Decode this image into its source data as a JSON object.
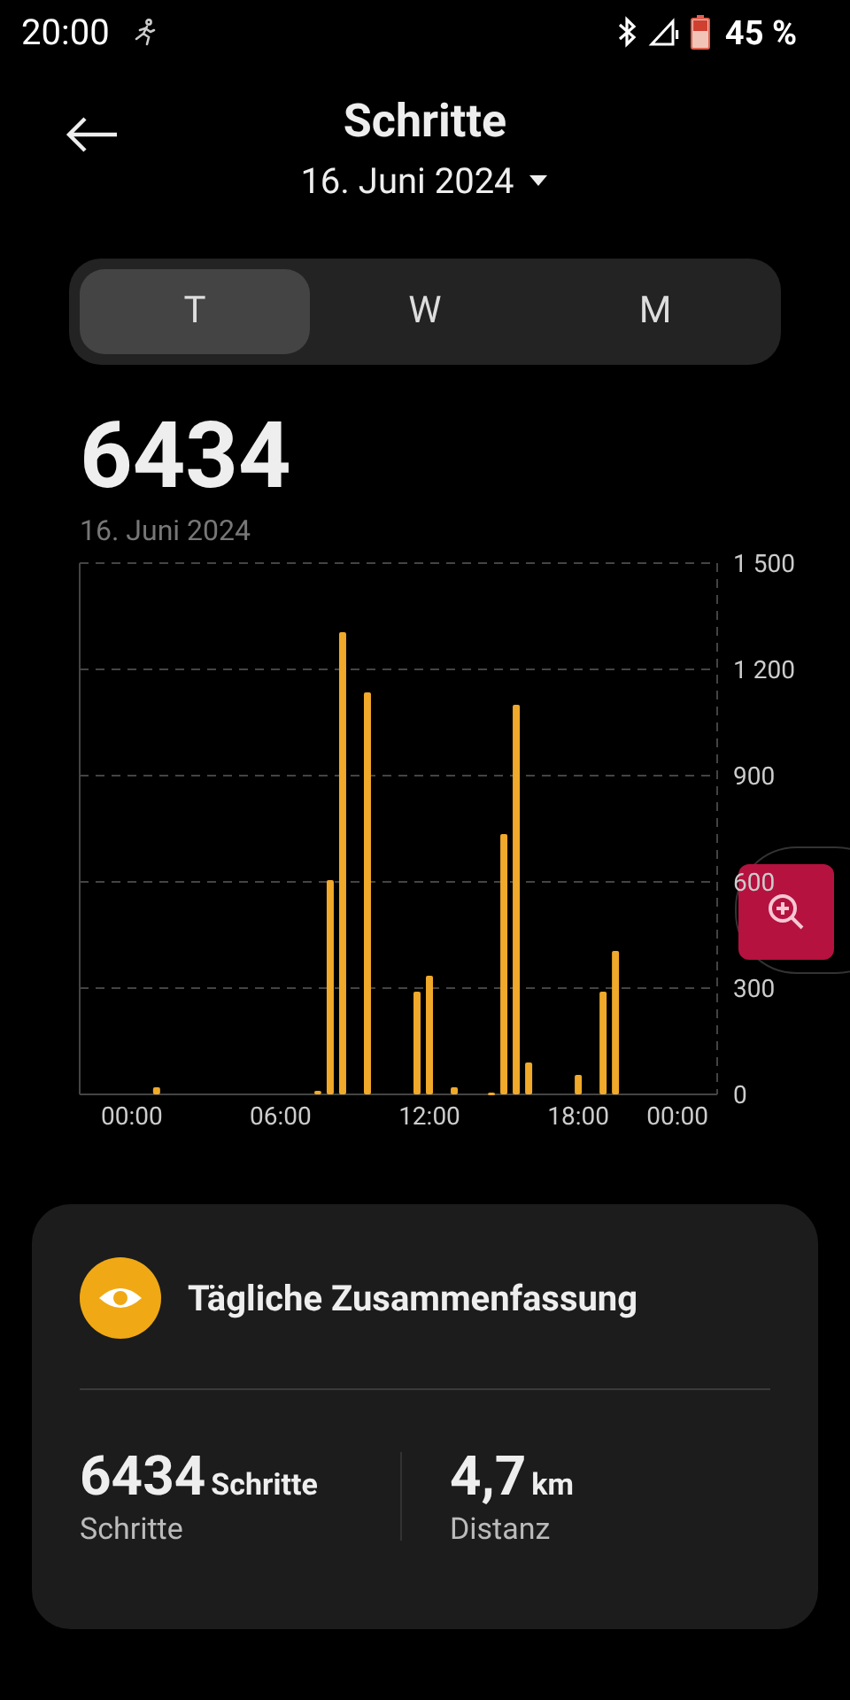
{
  "status_bar": {
    "time": "20:00",
    "battery": "45 %"
  },
  "header": {
    "title": "Schritte",
    "date": "16. Juni 2024"
  },
  "tabs": [
    {
      "label": "T",
      "selected": true
    },
    {
      "label": "W",
      "selected": false
    },
    {
      "label": "M",
      "selected": false
    }
  ],
  "total": {
    "value": "6434",
    "date": "16. Juni 2024"
  },
  "chart": {
    "chart_data": {
      "type": "bar",
      "x": [
        1,
        7.5,
        8,
        8.5,
        9.5,
        11.5,
        12,
        13,
        14.5,
        15,
        15.5,
        16,
        18,
        19,
        19.5
      ],
      "grid": true,
      "series": [
        {
          "color": "#f0a92a",
          "values": [
            20,
            10,
            605,
            1305,
            1135,
            290,
            335,
            20,
            5,
            735,
            1100,
            90,
            55,
            290,
            405
          ]
        }
      ],
      "xlim": [
        -2.1,
        23.6
      ],
      "ylim": [
        0,
        1500
      ],
      "xticks": [
        {
          "value": 0,
          "label": "00:00"
        },
        {
          "value": 6,
          "label": "06:00"
        },
        {
          "value": 12,
          "label": "12:00"
        },
        {
          "value": 18,
          "label": "18:00"
        },
        {
          "value": 22,
          "label": "00:00"
        }
      ],
      "yticks": [
        {
          "value": 0,
          "label": "0"
        },
        {
          "value": 300,
          "label": "300"
        },
        {
          "value": 600,
          "label": "600"
        },
        {
          "value": 900,
          "label": "900"
        },
        {
          "value": 1200,
          "label": "1 200"
        },
        {
          "value": 1500,
          "label": "1 500"
        }
      ]
    }
  },
  "summary": {
    "title": "Tägliche Zusammenfassung",
    "stats": [
      {
        "value": "6434",
        "unit": "Schritte",
        "label": "Schritte"
      },
      {
        "value": "4,7",
        "unit": "km",
        "label": "Distanz"
      }
    ]
  }
}
